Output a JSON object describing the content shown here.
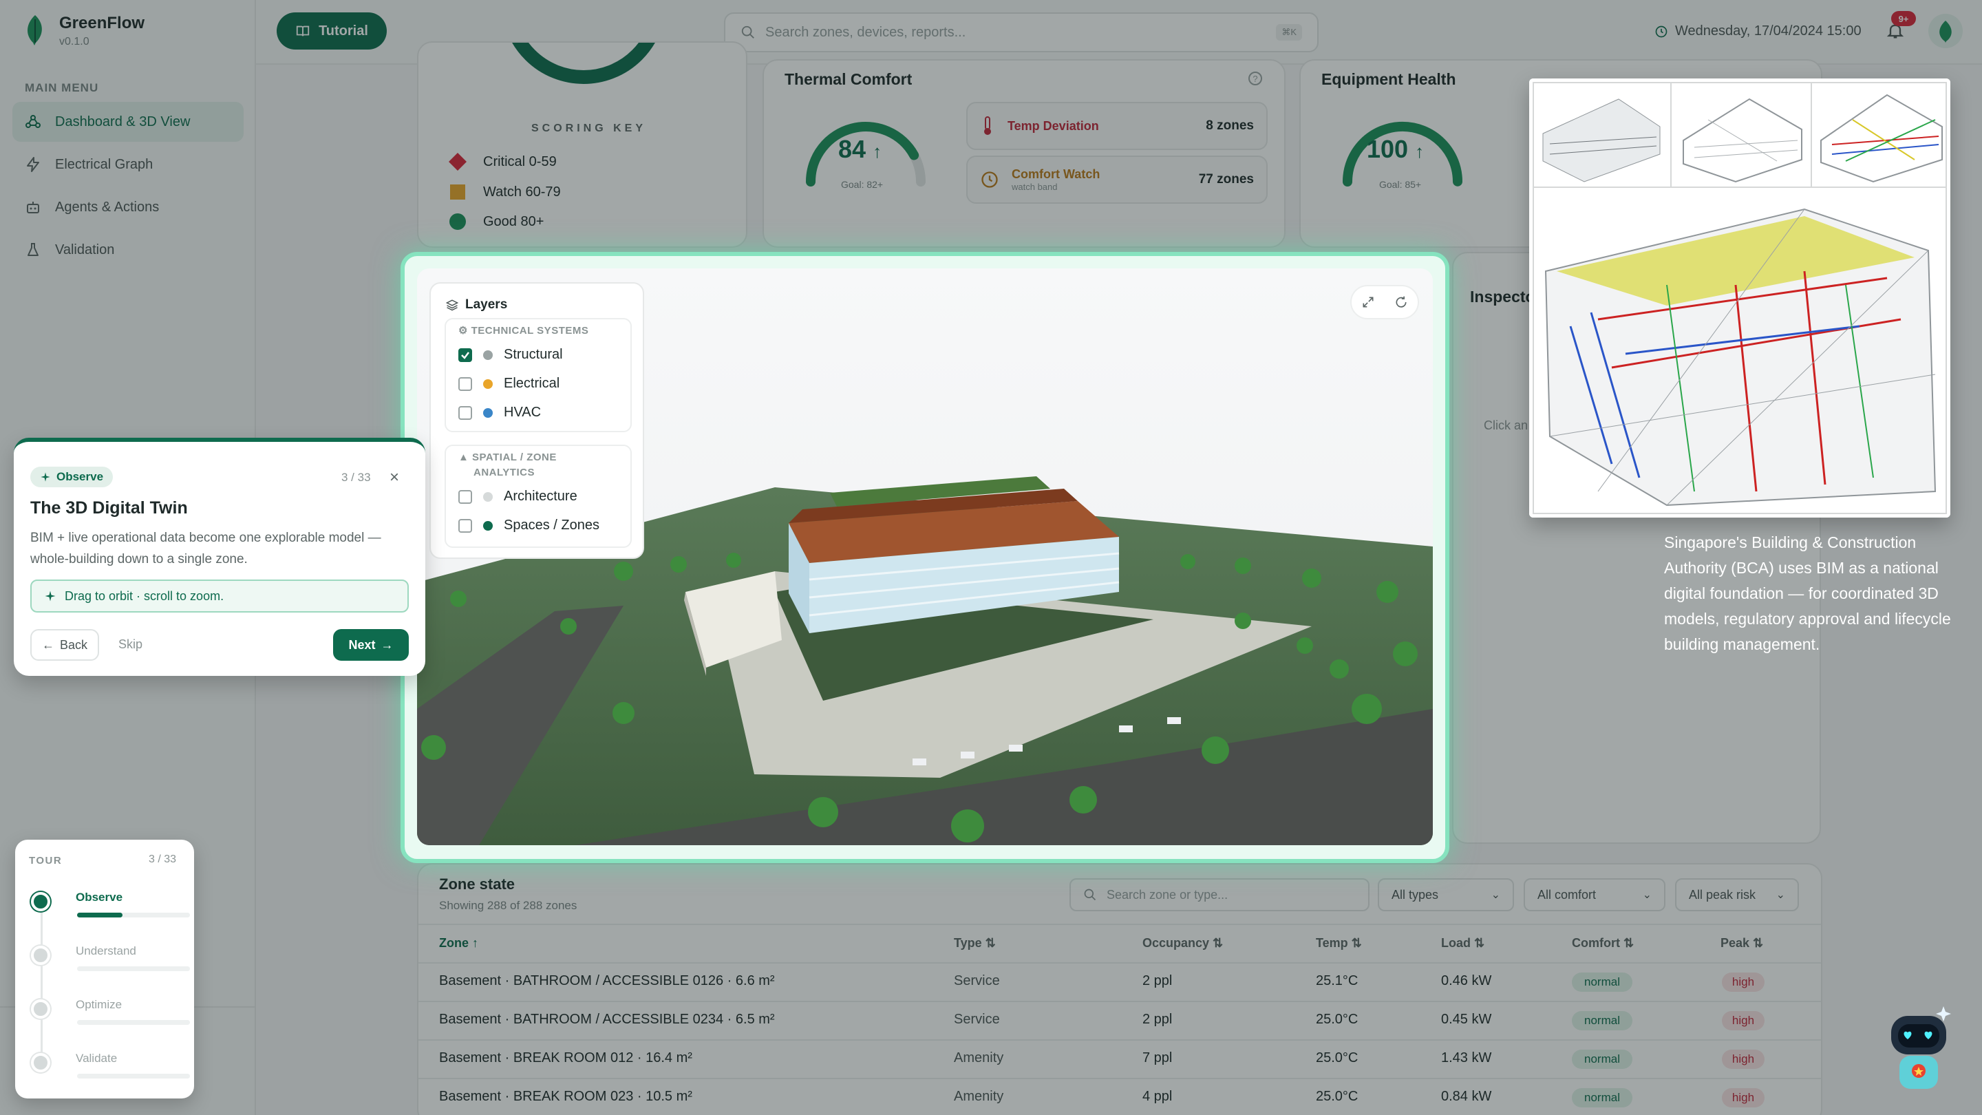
{
  "app": {
    "name": "GreenFlow",
    "version": "v0.1.0"
  },
  "sidebar": {
    "caption": "MAIN MENU",
    "items": [
      {
        "label": "Dashboard & 3D View",
        "icon": "cube-network-icon",
        "active": true
      },
      {
        "label": "Electrical Graph",
        "icon": "lightning-icon",
        "active": false
      },
      {
        "label": "Agents & Actions",
        "icon": "robot-icon",
        "active": false
      },
      {
        "label": "Validation",
        "icon": "flask-icon",
        "active": false
      }
    ]
  },
  "topbar": {
    "tutorial_label": "Tutorial",
    "search_placeholder": "Search zones, devices, reports...",
    "search_shortcut": "⌘K",
    "datetime": "Wednesday, 17/04/2024 15:00",
    "notification_count": "9+"
  },
  "scoring": {
    "caption": "SCORING KEY",
    "items": [
      {
        "label": "Critical 0-59",
        "color": "#d9263a",
        "shape": "diamond"
      },
      {
        "label": "Watch 60-79",
        "color": "#e9a52a",
        "shape": "square"
      },
      {
        "label": "Good 80+",
        "color": "#1c8f5a",
        "shape": "circle"
      }
    ]
  },
  "thermal": {
    "title": "Thermal Comfort",
    "score": "84",
    "score_value": 84,
    "goal": "Goal: 82+",
    "metrics": [
      {
        "label": "Temp Deviation",
        "sub": "",
        "value": "8 zones",
        "color": "#c0263a"
      },
      {
        "label": "Comfort Watch",
        "sub": "watch band",
        "value": "77 zones",
        "color": "#b9791a"
      }
    ]
  },
  "equipment": {
    "title": "Equipment Health",
    "score": "100",
    "score_value": 100,
    "goal": "Goal: 85+"
  },
  "inspector": {
    "title": "Inspecto",
    "hint": "Click an"
  },
  "layers": {
    "title": "Layers",
    "technical_caption": "TECHNICAL SYSTEMS",
    "technical": [
      {
        "label": "Structural",
        "checked": true,
        "color": "#9aa3a3"
      },
      {
        "label": "Electrical",
        "checked": false,
        "color": "#e9a52a"
      },
      {
        "label": "HVAC",
        "checked": false,
        "color": "#3a86c8"
      }
    ],
    "spatial_caption_1": "SPATIAL / ZONE",
    "spatial_caption_2": "ANALYTICS",
    "spatial": [
      {
        "label": "Architecture",
        "checked": false,
        "color": "#d6dada"
      },
      {
        "label": "Spaces / Zones",
        "checked": false,
        "color": "#0e6b4e"
      }
    ]
  },
  "tour_card": {
    "chip": "Observe",
    "step": "3 / 33",
    "title": "The 3D Digital Twin",
    "body": "BIM + live operational data become one explorable model — whole-building down to a single zone.",
    "hint": "Drag to orbit · scroll to zoom.",
    "back": "Back",
    "skip": "Skip",
    "next": "Next"
  },
  "tour_panel": {
    "caption": "TOUR",
    "count": "3 / 33",
    "steps": [
      {
        "label": "Observe",
        "active": true,
        "progress": 0.4
      },
      {
        "label": "Understand",
        "active": false,
        "progress": 0
      },
      {
        "label": "Optimize",
        "active": false,
        "progress": 0
      },
      {
        "label": "Validate",
        "active": false,
        "progress": 0
      }
    ]
  },
  "bim_caption": "Singapore's Building & Construction Authority (BCA) uses BIM as a national digital foundation — for coordinated 3D models, regulatory approval and lifecycle building management.",
  "zones": {
    "title": "Zone state",
    "subtitle": "Showing 288 of 288 zones",
    "search_placeholder": "Search zone or type...",
    "filters": [
      "All types",
      "All comfort",
      "All peak risk"
    ],
    "columns": [
      "Zone ↑",
      "Type ⇅",
      "Occupancy ⇅",
      "Temp ⇅",
      "Load ⇅",
      "Comfort ⇅",
      "Peak ⇅"
    ],
    "rows": [
      {
        "zone": "Basement · BATHROOM / ACCESSIBLE 0126 · 6.6 m²",
        "type": "Service",
        "occupancy": "2 ppl",
        "temp": "25.1°C",
        "load": "0.46 kW",
        "comfort": "normal",
        "peak": "high"
      },
      {
        "zone": "Basement · BATHROOM / ACCESSIBLE 0234 · 6.5 m²",
        "type": "Service",
        "occupancy": "2 ppl",
        "temp": "25.0°C",
        "load": "0.45 kW",
        "comfort": "normal",
        "peak": "high"
      },
      {
        "zone": "Basement · BREAK ROOM 012 · 16.4 m²",
        "type": "Amenity",
        "occupancy": "7 ppl",
        "temp": "25.0°C",
        "load": "1.43 kW",
        "comfort": "normal",
        "peak": "high"
      },
      {
        "zone": "Basement · BREAK ROOM 023 · 10.5 m²",
        "type": "Amenity",
        "occupancy": "4 ppl",
        "temp": "25.0°C",
        "load": "0.84 kW",
        "comfort": "normal",
        "peak": "high"
      }
    ]
  }
}
